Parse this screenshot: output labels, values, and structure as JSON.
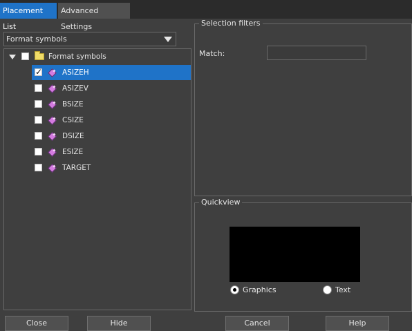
{
  "tabs": [
    {
      "label": "Placement List",
      "active": true
    },
    {
      "label": "Advanced Settings",
      "active": false
    }
  ],
  "dropdown": {
    "value": "Format symbols"
  },
  "tree": {
    "root": {
      "label": "Format symbols",
      "checked": false,
      "expanded": true
    },
    "items": [
      {
        "label": "ASIZEH",
        "checked": true,
        "selected": true
      },
      {
        "label": "ASIZEV",
        "checked": false
      },
      {
        "label": "BSIZE",
        "checked": false
      },
      {
        "label": "CSIZE",
        "checked": false
      },
      {
        "label": "DSIZE",
        "checked": false
      },
      {
        "label": "ESIZE",
        "checked": false
      },
      {
        "label": "TARGET",
        "checked": false
      }
    ]
  },
  "filters": {
    "title": "Selection filters",
    "match_label": "Match:",
    "match_value": ""
  },
  "quickview": {
    "title": "Quickview",
    "options": [
      {
        "label": "Graphics",
        "selected": true
      },
      {
        "label": "Text",
        "selected": false
      }
    ]
  },
  "buttons": {
    "close": "Close",
    "hide": "Hide",
    "cancel": "Cancel",
    "help": "Help"
  },
  "colors": {
    "background": "#3f3f3f",
    "accent": "#1f73c8",
    "tabbar": "#2b2b2b"
  }
}
